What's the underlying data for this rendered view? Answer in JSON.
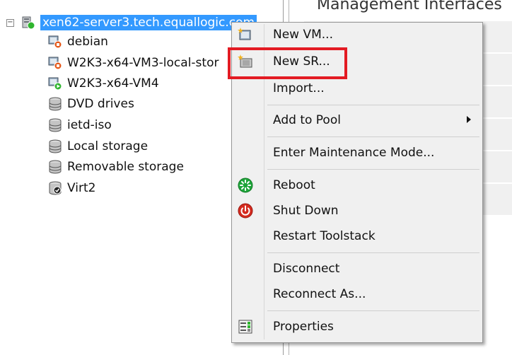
{
  "background_panel": {
    "header": "Management Interfaces"
  },
  "tree": {
    "root": {
      "label": "xen62-server3.tech.equallogic.com",
      "icon": "server-running-icon"
    },
    "children": [
      {
        "label": "debian",
        "icon": "vm-stopped-icon"
      },
      {
        "label": "W2K3-x64-VM3-local-stor",
        "icon": "vm-stopped-icon"
      },
      {
        "label": "W2K3-x64-VM4",
        "icon": "vm-running-icon"
      },
      {
        "label": "DVD drives",
        "icon": "storage-icon"
      },
      {
        "label": "ietd-iso",
        "icon": "storage-icon"
      },
      {
        "label": "Local storage",
        "icon": "storage-icon"
      },
      {
        "label": "Removable storage",
        "icon": "storage-icon"
      },
      {
        "label": "Virt2",
        "icon": "storage-default-icon"
      }
    ]
  },
  "context_menu": {
    "items": [
      {
        "label": "New VM...",
        "icon": "new-vm-icon"
      },
      {
        "label": "New SR...",
        "icon": "new-sr-icon"
      },
      {
        "label": "Import..."
      },
      {
        "label": "Add to Pool",
        "submenu": true
      },
      {
        "label": "Enter Maintenance Mode..."
      },
      {
        "label": "Reboot",
        "icon": "reboot-icon"
      },
      {
        "label": "Shut Down",
        "icon": "shutdown-icon"
      },
      {
        "label": "Restart Toolstack"
      },
      {
        "label": "Disconnect"
      },
      {
        "label": "Reconnect As..."
      },
      {
        "label": "Properties",
        "icon": "properties-icon"
      }
    ]
  },
  "colors": {
    "selection": "#3399ff",
    "highlight_box": "#e31b23",
    "running_green": "#2fb52f",
    "stopped_orange": "#e5591b"
  }
}
